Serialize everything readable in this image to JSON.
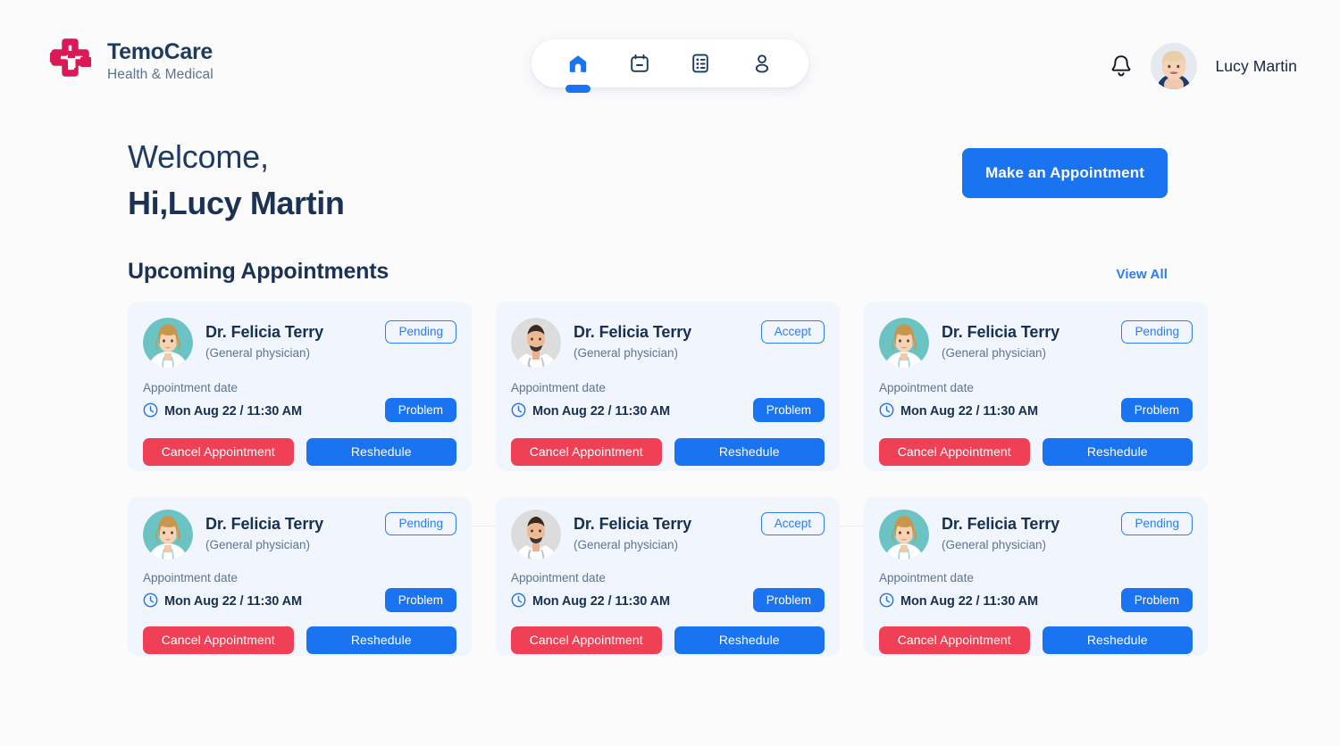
{
  "brand": {
    "name": "TemoCare",
    "tagline": "Health & Medical",
    "logo_icon": "medical-cross-icon",
    "logo_color": "#da1a55",
    "text_color": "#1e3a5f"
  },
  "nav": {
    "items": [
      {
        "icon": "home-icon",
        "label": "Home",
        "active": true
      },
      {
        "icon": "calendar-icon",
        "label": "Calendar",
        "active": false
      },
      {
        "icon": "records-icon",
        "label": "Records",
        "active": false
      },
      {
        "icon": "profile-icon",
        "label": "Profile",
        "active": false
      }
    ],
    "active_color": "#1a73f0"
  },
  "header": {
    "notification_icon": "bell-icon",
    "avatar_icon": "user-avatar",
    "user_name": "Lucy Martin"
  },
  "welcome": {
    "line1": "Welcome,",
    "line2": "Hi,Lucy Martin"
  },
  "actions": {
    "make_appointment": "Make an Appointment"
  },
  "section": {
    "title": "Upcoming Appointments",
    "view_all": "View All"
  },
  "card_labels": {
    "date_label": "Appointment date",
    "problem": "Problem",
    "cancel": "Cancel Appointment",
    "reschedule": "Reshedule",
    "clock_icon": "clock-icon"
  },
  "colors": {
    "page_bg": "#fbfbfc",
    "card_bg": "#f1f5fd",
    "primary_blue": "#1a73f0",
    "danger_red": "#ef4056",
    "navy": "#16304f",
    "muted": "#5f7490"
  },
  "appointments": [
    {
      "doctor": "Dr. Felicia Terry",
      "specialty": "(General physician)",
      "status": "Pending",
      "date_label": "Appointment date",
      "date_value": "Mon Aug 22 / 11:30 AM",
      "problem": "Problem",
      "cancel": "Cancel Appointment",
      "reschedule": "Reshedule",
      "avatar_type": "female-doctor"
    },
    {
      "doctor": "Dr. Felicia Terry",
      "specialty": "(General physician)",
      "status": "Accept",
      "date_label": "Appointment date",
      "date_value": "Mon Aug 22 / 11:30 AM",
      "problem": "Problem",
      "cancel": "Cancel Appointment",
      "reschedule": "Reshedule",
      "avatar_type": "male-doctor"
    },
    {
      "doctor": "Dr. Felicia Terry",
      "specialty": "(General physician)",
      "status": "Pending",
      "date_label": "Appointment date",
      "date_value": "Mon Aug 22 / 11:30 AM",
      "problem": "Problem",
      "cancel": "Cancel Appointment",
      "reschedule": "Reshedule",
      "avatar_type": "female-doctor"
    },
    {
      "doctor": "Dr. Felicia Terry",
      "specialty": "(General physician)",
      "status": "Pending",
      "date_label": "Appointment date",
      "date_value": "Mon Aug 22 / 11:30 AM",
      "problem": "Problem",
      "cancel": "Cancel Appointment",
      "reschedule": "Reshedule",
      "avatar_type": "female-doctor"
    },
    {
      "doctor": "Dr. Felicia Terry",
      "specialty": "(General physician)",
      "status": "Accept",
      "date_label": "Appointment date",
      "date_value": "Mon Aug 22 / 11:30 AM",
      "problem": "Problem",
      "cancel": "Cancel Appointment",
      "reschedule": "Reshedule",
      "avatar_type": "male-doctor"
    },
    {
      "doctor": "Dr. Felicia Terry",
      "specialty": "(General physician)",
      "status": "Pending",
      "date_label": "Appointment date",
      "date_value": "Mon Aug 22 / 11:30 AM",
      "problem": "Problem",
      "cancel": "Cancel Appointment",
      "reschedule": "Reshedule",
      "avatar_type": "female-doctor"
    }
  ]
}
